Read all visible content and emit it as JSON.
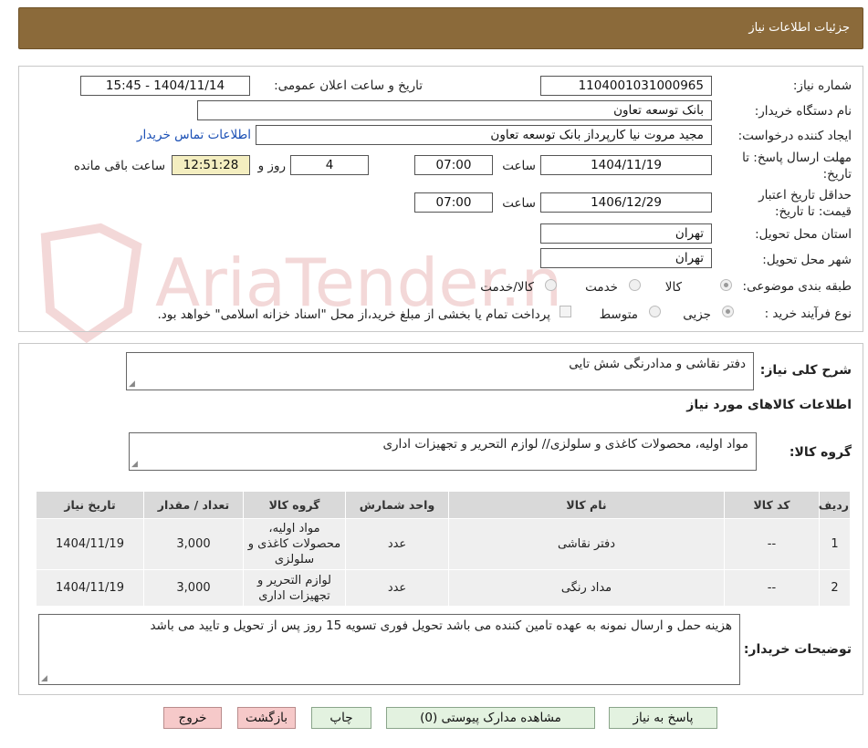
{
  "header": {
    "title": "جزئیات اطلاعات نیاز"
  },
  "watermark": {
    "text": "AriaTender.neT"
  },
  "info": {
    "need_number_label": "شماره نیاز:",
    "need_number": "1104001031000965",
    "announce_label": "تاریخ و ساعت اعلان عمومی:",
    "announce_value": "1404/11/14 - 15:45",
    "buyer_org_label": "نام دستگاه خریدار:",
    "buyer_org": "بانک توسعه تعاون",
    "creator_label": "ایجاد کننده درخواست:",
    "creator": "مجید مروت نیا کارپرداز بانک توسعه تعاون",
    "contact_link": "اطلاعات تماس خریدار",
    "reply_deadline_label": "مهلت ارسال پاسخ: تا تاریخ:",
    "reply_date": "1404/11/19",
    "time_label": "ساعت",
    "reply_time": "07:00",
    "days": "4",
    "days_label": "روز و",
    "remaining_time": "12:51:28",
    "remaining_label": "ساعت باقی مانده",
    "validity_label": "حداقل تاریخ اعتبار قیمت: تا تاریخ:",
    "validity_date": "1406/12/29",
    "validity_time": "07:00",
    "province_label": "استان محل تحویل:",
    "province": "تهران",
    "city_label": "شهر محل تحویل:",
    "city": "تهران",
    "category_label": "طبقه بندی موضوعی:",
    "category_options": [
      "کالا",
      "خدمت",
      "کالا/خدمت"
    ],
    "process_label": "نوع فرآیند خرید :",
    "process_options": [
      "جزیی",
      "متوسط"
    ],
    "payment_note": "پرداخت تمام یا بخشی از مبلغ خرید،از محل \"اسناد خزانه اسلامی\" خواهد بود."
  },
  "description": {
    "label": "شرح کلی نیاز:",
    "value": "دفتر نقاشی و مدادرنگی شش تایی"
  },
  "goods": {
    "section_title": "اطلاعات کالاهای مورد نیاز",
    "group_label": "گروه کالا:",
    "group_value": "مواد اولیه، محصولات کاغذی و سلولزی// لوازم التحریر و تجهیزات اداری",
    "columns": [
      "ردیف",
      "کد کالا",
      "نام کالا",
      "واحد شمارش",
      "گروه کالا",
      "تعداد / مقدار",
      "تاریخ نیاز"
    ],
    "rows": [
      [
        "1",
        "--",
        "دفتر نقاشی",
        "عدد",
        "مواد اولیه، محصولات کاغذی و سلولزی",
        "3,000",
        "1404/11/19"
      ],
      [
        "2",
        "--",
        "مداد رنگی",
        "عدد",
        "لوازم التحریر و تجهیزات اداری",
        "3,000",
        "1404/11/19"
      ]
    ]
  },
  "buyer_notes": {
    "label": "توضیحات خریدار:",
    "value": "هزینه حمل و ارسال نمونه به عهده تامین کننده می باشد تحویل فوری تسویه 15 روز پس از تحویل و تایید می باشد"
  },
  "buttons": {
    "reply": "پاسخ به نیاز",
    "attachments": "مشاهده مدارک پیوستی (0)",
    "print": "چاپ",
    "back": "بازگشت",
    "exit": "خروج"
  },
  "colors": {
    "header_bg": "#8b6a3a",
    "button_bg": "#e3f2e0",
    "button_red_bg": "#f6c9c9",
    "link": "#1a4fb5"
  }
}
